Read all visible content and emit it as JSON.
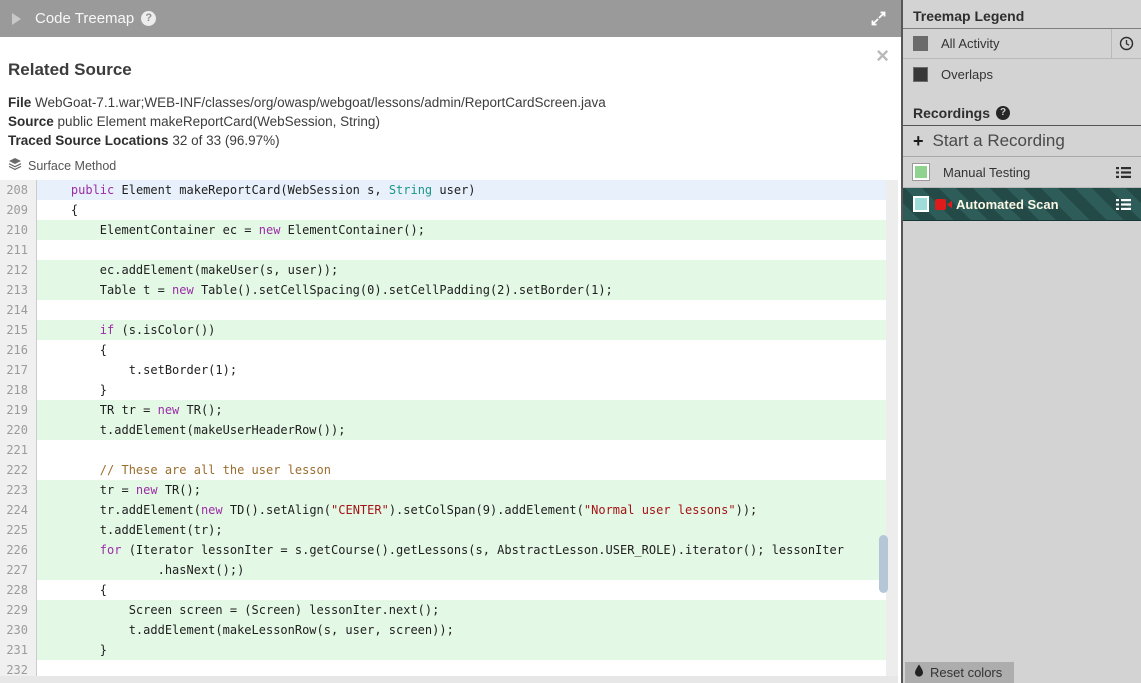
{
  "header": {
    "title": "Code Treemap",
    "help": "?"
  },
  "related_source": {
    "title": "Related Source",
    "file_label": "File",
    "file_value": "WebGoat-7.1.war;WEB-INF/classes/org/owasp/webgoat/lessons/admin/ReportCardScreen.java",
    "source_label": "Source",
    "source_value": "public Element makeReportCard(WebSession, String)",
    "traced_label": "Traced Source Locations",
    "traced_value": "32 of 33 (96.97%)",
    "method_tag": "Surface Method",
    "close_glyph": "×"
  },
  "code": {
    "lines": [
      {
        "n": 208,
        "bg": "blue",
        "parts": [
          {
            "t": "    "
          },
          {
            "t": "public",
            "c": "kw"
          },
          {
            "t": " Element makeReportCard(WebSession s, "
          },
          {
            "t": "String",
            "c": "type"
          },
          {
            "t": " user)"
          }
        ]
      },
      {
        "n": 209,
        "bg": "",
        "parts": [
          {
            "t": "    {"
          }
        ]
      },
      {
        "n": 210,
        "bg": "green",
        "parts": [
          {
            "t": "        ElementContainer ec = "
          },
          {
            "t": "new",
            "c": "kw"
          },
          {
            "t": " ElementContainer();"
          }
        ]
      },
      {
        "n": 211,
        "bg": "",
        "parts": [
          {
            "t": ""
          }
        ]
      },
      {
        "n": 212,
        "bg": "green",
        "parts": [
          {
            "t": "        ec.addElement(makeUser(s, user));"
          }
        ]
      },
      {
        "n": 213,
        "bg": "green",
        "parts": [
          {
            "t": "        Table t = "
          },
          {
            "t": "new",
            "c": "kw"
          },
          {
            "t": " Table().setCellSpacing(0).setCellPadding(2).setBorder(1);"
          }
        ]
      },
      {
        "n": 214,
        "bg": "",
        "parts": [
          {
            "t": ""
          }
        ]
      },
      {
        "n": 215,
        "bg": "green",
        "parts": [
          {
            "t": "        "
          },
          {
            "t": "if",
            "c": "kw"
          },
          {
            "t": " (s.isColor())"
          }
        ]
      },
      {
        "n": 216,
        "bg": "",
        "parts": [
          {
            "t": "        {"
          }
        ]
      },
      {
        "n": 217,
        "bg": "",
        "parts": [
          {
            "t": "            t.setBorder(1);"
          }
        ]
      },
      {
        "n": 218,
        "bg": "",
        "parts": [
          {
            "t": "        }"
          }
        ]
      },
      {
        "n": 219,
        "bg": "green",
        "parts": [
          {
            "t": "        TR tr = "
          },
          {
            "t": "new",
            "c": "kw"
          },
          {
            "t": " TR();"
          }
        ]
      },
      {
        "n": 220,
        "bg": "green",
        "parts": [
          {
            "t": "        t.addElement(makeUserHeaderRow());"
          }
        ]
      },
      {
        "n": 221,
        "bg": "",
        "parts": [
          {
            "t": ""
          }
        ]
      },
      {
        "n": 222,
        "bg": "",
        "parts": [
          {
            "t": "        "
          },
          {
            "t": "// These are all the user lesson",
            "c": "cm"
          }
        ]
      },
      {
        "n": 223,
        "bg": "green",
        "parts": [
          {
            "t": "        tr = "
          },
          {
            "t": "new",
            "c": "kw"
          },
          {
            "t": " TR();"
          }
        ]
      },
      {
        "n": 224,
        "bg": "green",
        "parts": [
          {
            "t": "        tr.addElement("
          },
          {
            "t": "new",
            "c": "kw"
          },
          {
            "t": " TD().setAlign("
          },
          {
            "t": "\"CENTER\"",
            "c": "str"
          },
          {
            "t": ").setColSpan(9).addElement("
          },
          {
            "t": "\"Normal user lessons\"",
            "c": "str"
          },
          {
            "t": "));"
          }
        ]
      },
      {
        "n": 225,
        "bg": "green",
        "parts": [
          {
            "t": "        t.addElement(tr);"
          }
        ]
      },
      {
        "n": 226,
        "bg": "green",
        "parts": [
          {
            "t": "        "
          },
          {
            "t": "for",
            "c": "kw"
          },
          {
            "t": " (Iterator lessonIter = s.getCourse().getLessons(s, AbstractLesson.USER_ROLE).iterator(); lessonIter"
          }
        ]
      },
      {
        "n": 227,
        "bg": "green",
        "parts": [
          {
            "t": "                .hasNext();)"
          }
        ]
      },
      {
        "n": 228,
        "bg": "",
        "parts": [
          {
            "t": "        {"
          }
        ]
      },
      {
        "n": 229,
        "bg": "green",
        "parts": [
          {
            "t": "            Screen screen = (Screen) lessonIter.next();"
          }
        ]
      },
      {
        "n": 230,
        "bg": "green",
        "parts": [
          {
            "t": "            t.addElement(makeLessonRow(s, user, screen));"
          }
        ]
      },
      {
        "n": 231,
        "bg": "green",
        "parts": [
          {
            "t": "        }"
          }
        ]
      },
      {
        "n": 232,
        "bg": "",
        "parts": [
          {
            "t": ""
          }
        ]
      }
    ]
  },
  "sidebar": {
    "treemap_legend": {
      "title": "Treemap Legend",
      "items": [
        {
          "label": "All Activity",
          "swatch": "#6b6b6b",
          "trailing_icon": "clock"
        },
        {
          "label": "Overlaps",
          "swatch": "#383838"
        }
      ]
    },
    "recordings": {
      "title": "Recordings",
      "help": "?",
      "start_label": "Start a Recording",
      "plus_glyph": "+",
      "items": [
        {
          "label": "Manual Testing",
          "swatch": "#8fd38f",
          "selected": false
        },
        {
          "label": "Automated Scan",
          "swatch": "#9edcda",
          "selected": true,
          "leading_icon": "video-camera"
        }
      ]
    },
    "reset_label": "Reset colors"
  },
  "colors": {
    "highlight_green": "#e4f8e6",
    "highlight_blue": "#e8f1fb",
    "keyword": "#9b2da6",
    "string": "#a31515",
    "comment": "#9a6d2e",
    "type": "#1b9588",
    "selected_row_stripe_dark": "#234a47",
    "selected_row_stripe_light": "#2e5c58",
    "scroll_thumb": "#b5c6d7",
    "camera_icon_red": "#e01b1b"
  }
}
